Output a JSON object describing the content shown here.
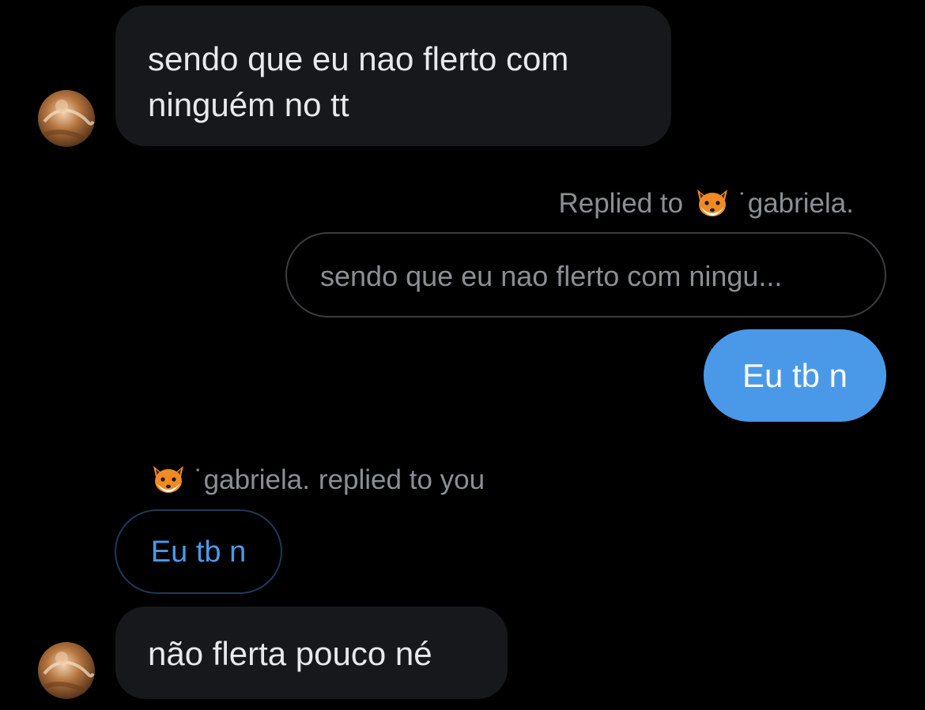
{
  "conversation": {
    "messages": [
      {
        "sender": "other",
        "text": "sendo que eu nao flerto com ninguém no tt"
      },
      {
        "sender": "me",
        "text": "Eu tb n"
      },
      {
        "sender": "other",
        "text": "não flerta pouco né"
      }
    ],
    "my_reply_context": {
      "prefix": "Replied to",
      "name": "˙gabriela.",
      "icon": "fox-emoji",
      "quoted_text": "sendo que eu nao flerto com ningu..."
    },
    "their_reply_context": {
      "name": "˙gabriela.",
      "suffix": "replied to you",
      "icon": "fox-emoji",
      "quoted_text": "Eu tb n"
    }
  },
  "colors": {
    "background": "#000000",
    "incoming_bubble": "#16181c",
    "outgoing_bubble": "#4a99e9",
    "muted_text": "#8b8f94",
    "accent": "#4a99e9"
  }
}
